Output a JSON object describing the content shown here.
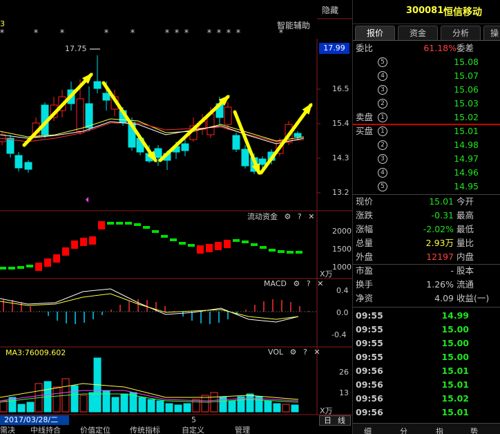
{
  "header": {
    "hide_label": "隐藏",
    "smart_assist": "智能辅助",
    "stock_code": "300081",
    "stock_name": "恒信移动",
    "fragment_left": "3",
    "price_flag": "17.99",
    "high_marker": "17.75"
  },
  "panels": {
    "fund_flow": {
      "title": "流动资金",
      "unit": "X万",
      "ticks": [
        "2000",
        "1500",
        "1000"
      ]
    },
    "macd": {
      "title": "MACD",
      "ticks": [
        "0.4",
        "0.0",
        "-0.4"
      ]
    },
    "vol": {
      "title": "VOL",
      "ma_label": "MA3:76009.602",
      "unit": "X万",
      "ticks": [
        "26",
        "13"
      ]
    }
  },
  "price_axis": [
    "16.5",
    "15.4",
    "14.3",
    "13.2"
  ],
  "bottom": {
    "date": "2017/03/28/二",
    "page_num": "5",
    "day_btn": "日",
    "line_btn": "线",
    "tabs": [
      "需决",
      "中线持合",
      "价值定位",
      "传统指标",
      "自定义",
      "管理"
    ]
  },
  "icons": {
    "gear": "gear-icon",
    "help": "question-icon",
    "close": "close-icon"
  },
  "colors": {
    "up": "#ff2020",
    "down": "#00e0e0",
    "ma_yellow": "#ffff40",
    "ma_red": "#ff3030",
    "ma_white": "#ffffff",
    "arrow": "#ffff00"
  },
  "right": {
    "tabs": [
      "报价",
      "资金",
      "分析",
      "操"
    ],
    "weibi": {
      "label": "委比",
      "value": "61.18%",
      "right": "委差"
    },
    "sells": [
      {
        "num": "5",
        "price": "15.08"
      },
      {
        "num": "4",
        "price": "15.07"
      },
      {
        "num": "3",
        "price": "15.06"
      },
      {
        "num": "2",
        "price": "15.03"
      },
      {
        "label": "卖盘",
        "num": "1",
        "price": "15.02"
      }
    ],
    "buys": [
      {
        "label": "买盘",
        "num": "1",
        "price": "15.01"
      },
      {
        "num": "2",
        "price": "14.98"
      },
      {
        "num": "3",
        "price": "14.97"
      },
      {
        "num": "4",
        "price": "14.96"
      },
      {
        "num": "5",
        "price": "14.95"
      }
    ],
    "stats": [
      {
        "l": "现价",
        "v": "15.01",
        "c": "green",
        "r": "今开"
      },
      {
        "l": "涨跌",
        "v": "-0.31",
        "c": "green",
        "r": "最高"
      },
      {
        "l": "涨幅",
        "v": "-2.02%",
        "c": "green",
        "r": "最低"
      },
      {
        "l": "总量",
        "v": "2.93万",
        "c": "yellow",
        "r": "量比"
      },
      {
        "l": "外盘",
        "v": "12197",
        "c": "red",
        "r": "内盘"
      },
      {
        "l": "市盈",
        "v": "-",
        "c": "white",
        "r": "股本"
      },
      {
        "l": "换手",
        "v": "1.26%",
        "c": "white",
        "r": "流通"
      },
      {
        "l": "净资",
        "v": "4.09",
        "c": "white",
        "r": "收益(一)"
      }
    ],
    "ticks": [
      {
        "t": "09:55",
        "p": "14.99"
      },
      {
        "t": "09:55",
        "p": "15.00"
      },
      {
        "t": "09:55",
        "p": "15.00"
      },
      {
        "t": "09:55",
        "p": "15.00"
      },
      {
        "t": "09:56",
        "p": "15.01"
      },
      {
        "t": "09:56",
        "p": "15.01"
      },
      {
        "t": "09:56",
        "p": "15.02"
      },
      {
        "t": "09:56",
        "p": "15.01"
      }
    ],
    "bottom_tabs": [
      "细",
      "分",
      "指",
      "势"
    ]
  }
}
